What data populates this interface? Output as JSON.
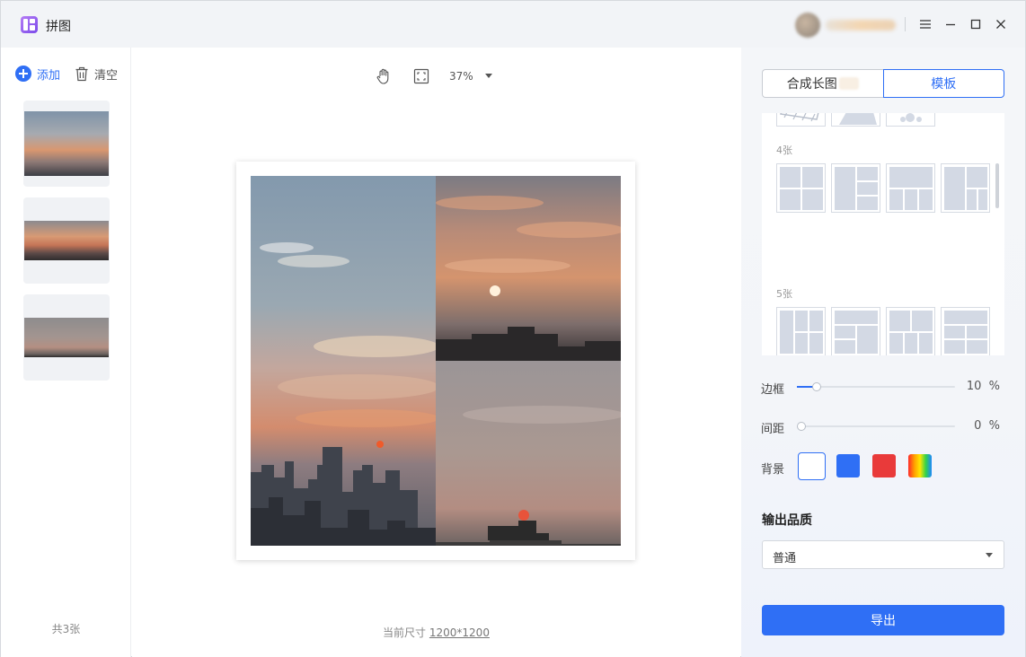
{
  "app": {
    "title": "拼图"
  },
  "window_controls": {
    "menu": "menu-icon",
    "minimize": "minimize-icon",
    "maximize": "maximize-icon",
    "close": "close-icon"
  },
  "sidebar": {
    "add_label": "添加",
    "clear_label": "清空",
    "count_label": "共3张",
    "thumbnails": [
      "sunset-1",
      "sunset-2",
      "sunset-3"
    ]
  },
  "toolbar": {
    "zoom": "37%",
    "hand_tool": "hand-icon",
    "fit_tool": "fit-screen-icon"
  },
  "canvas": {
    "size_prefix": "当前尺寸",
    "size_value": "1200*1200"
  },
  "panel": {
    "tabs": [
      {
        "label": "合成长图",
        "active": false
      },
      {
        "label": "模板",
        "active": true
      }
    ],
    "template_groups": [
      {
        "label": "4张"
      },
      {
        "label": "5张"
      }
    ],
    "border": {
      "label": "边框",
      "value": 10,
      "display": "10",
      "unit": "%"
    },
    "spacing": {
      "label": "间距",
      "value": 0,
      "display": "0",
      "unit": "%"
    },
    "background": {
      "label": "背景",
      "colors": [
        "#ffffff",
        "#2f6ff5",
        "#e93a3a",
        "rainbow"
      ],
      "selected": "#ffffff"
    },
    "quality": {
      "title": "输出品质",
      "selected": "普通"
    },
    "export_label": "导出"
  },
  "colors": {
    "accent": "#2f6ff5"
  }
}
